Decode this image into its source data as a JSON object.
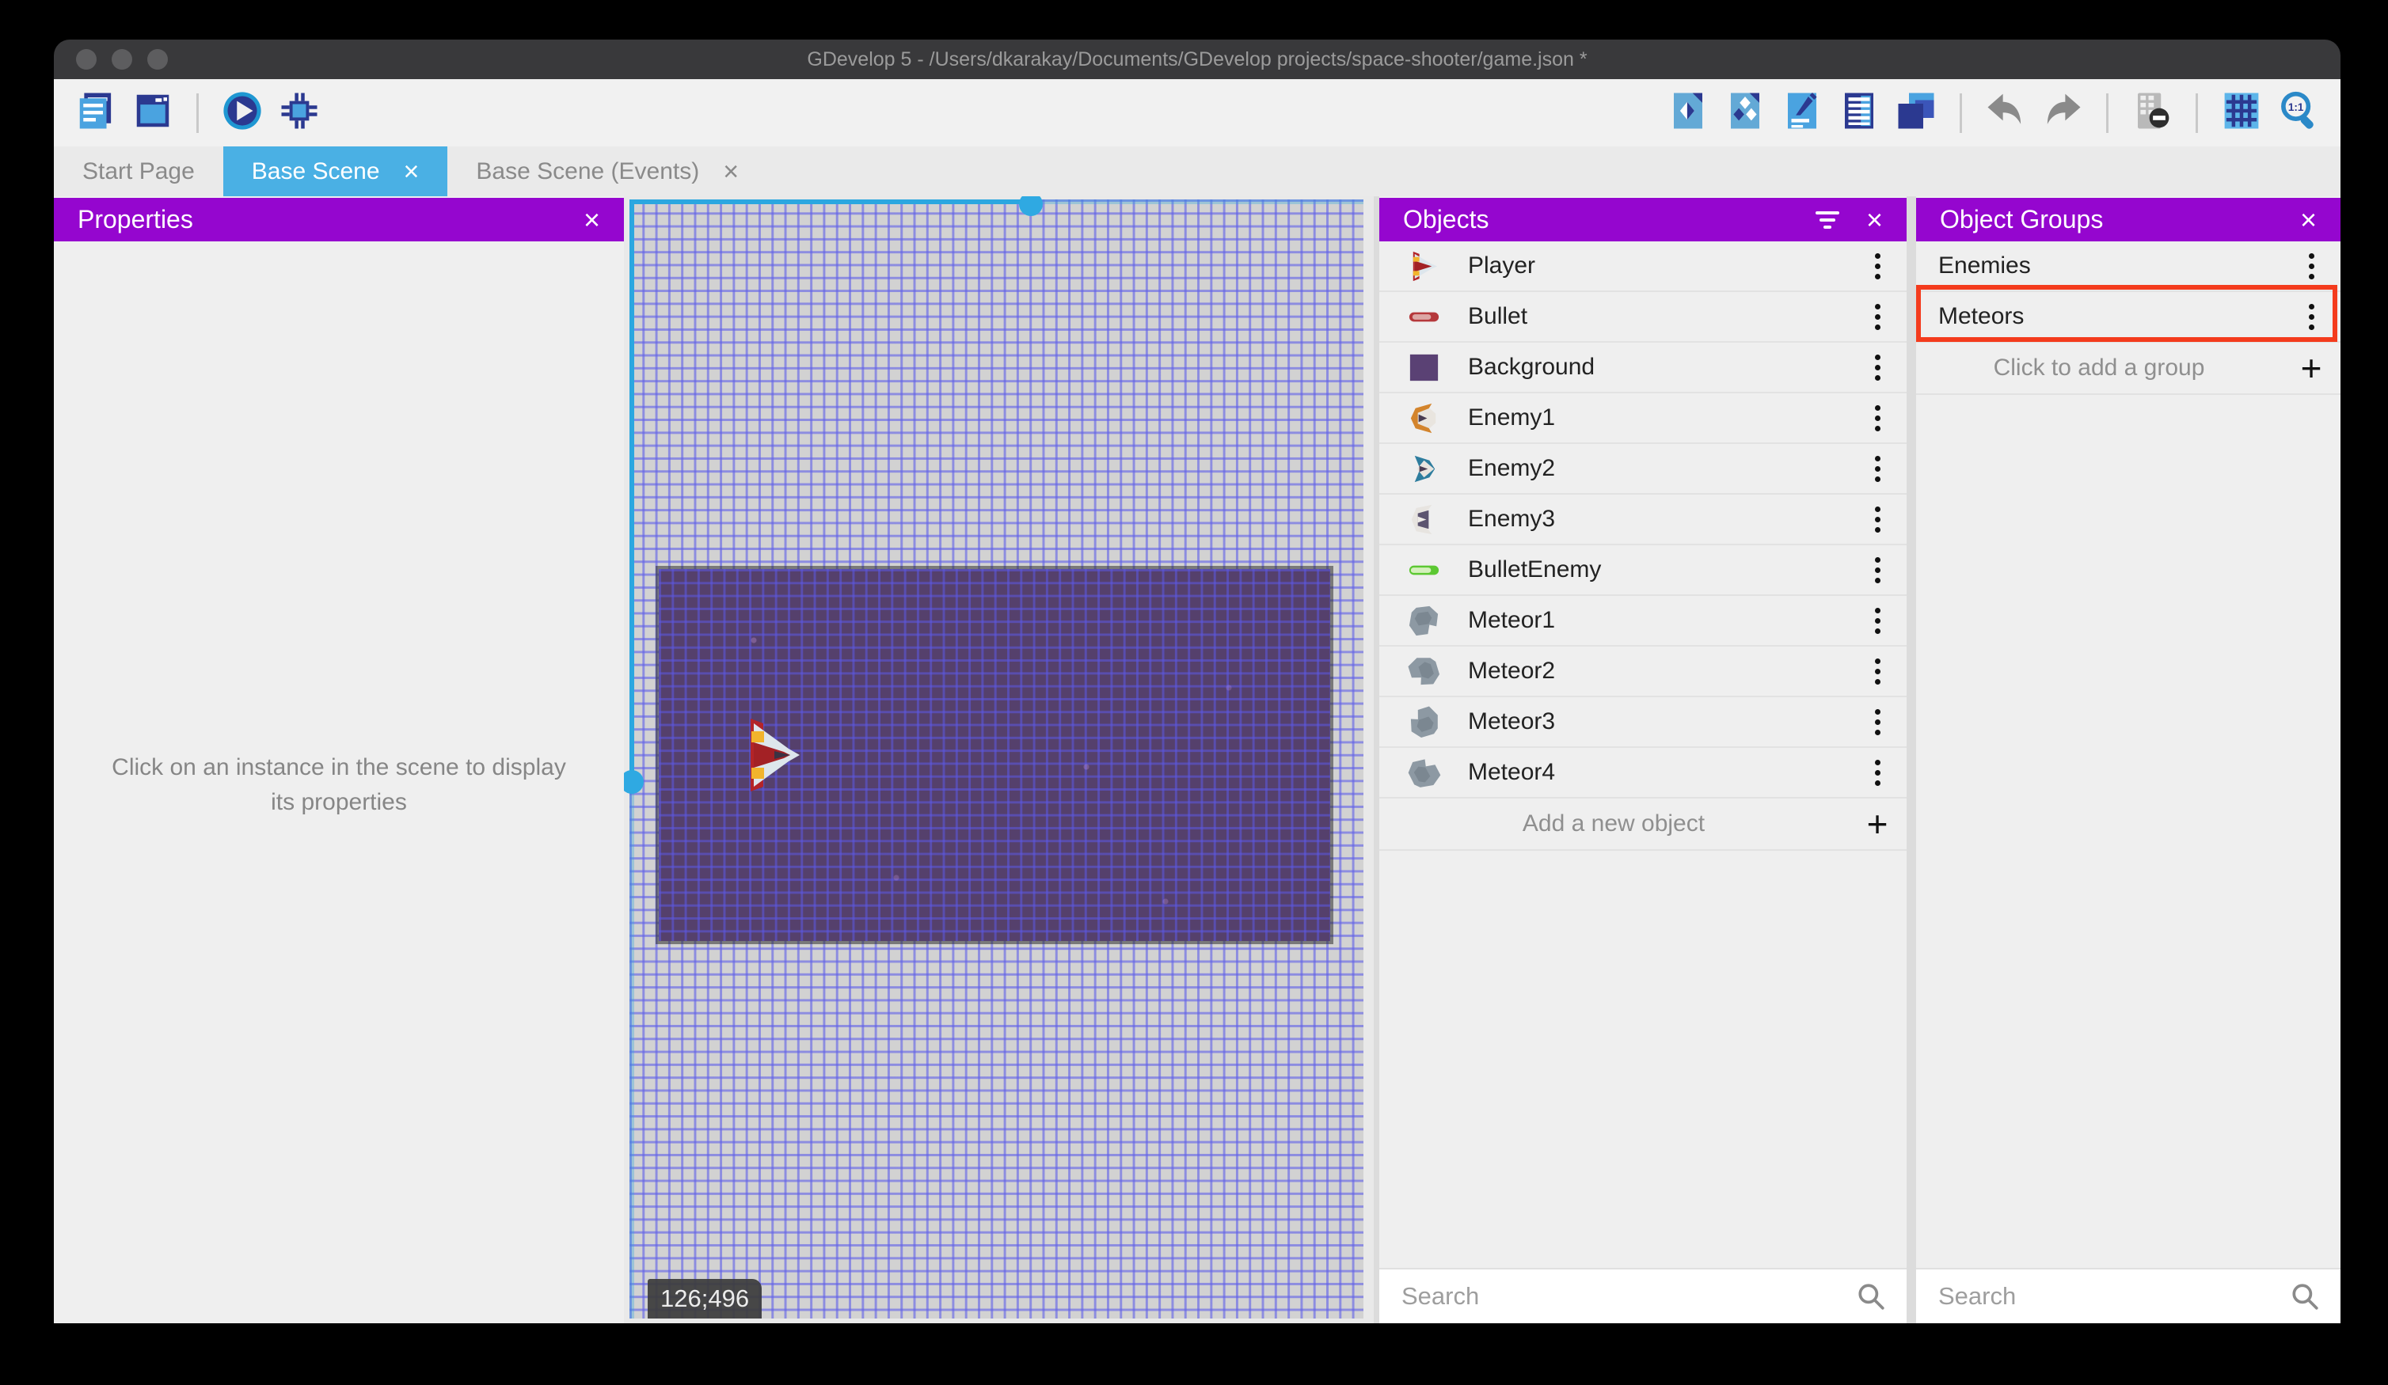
{
  "window": {
    "title": "GDevelop 5 - /Users/dkarakay/Documents/GDevelop projects/space-shooter/game.json *"
  },
  "toolbar": {
    "left": [
      {
        "name": "project-manager",
        "icon": "project-manager"
      },
      {
        "name": "start-page",
        "icon": "scene-window"
      },
      {
        "separator": true
      },
      {
        "name": "play",
        "icon": "play"
      },
      {
        "name": "debug",
        "icon": "debug"
      }
    ],
    "right": [
      {
        "name": "open-objects-panel",
        "icon": "objects-page"
      },
      {
        "name": "open-object-groups-panel",
        "icon": "object-groups-page"
      },
      {
        "name": "open-properties-panel",
        "icon": "properties-page"
      },
      {
        "name": "open-instances-list-panel",
        "icon": "instances-page"
      },
      {
        "name": "open-layers-panel",
        "icon": "layers"
      },
      {
        "separator": true
      },
      {
        "name": "undo",
        "icon": "undo"
      },
      {
        "name": "redo",
        "icon": "redo"
      },
      {
        "separator": true
      },
      {
        "name": "toggle-instances-mask",
        "icon": "mask"
      },
      {
        "separator": true
      },
      {
        "name": "toggle-grid",
        "icon": "grid"
      },
      {
        "name": "zoom-original",
        "icon": "zoom-1-1"
      }
    ]
  },
  "tabs": [
    {
      "label": "Start Page",
      "active": false,
      "closable": false
    },
    {
      "label": "Base Scene",
      "active": true,
      "closable": true
    },
    {
      "label": "Base Scene (Events)",
      "active": false,
      "closable": true
    }
  ],
  "properties_panel": {
    "title": "Properties",
    "empty_text": "Click on an instance in the scene to display its properties"
  },
  "scene_canvas": {
    "cursor_coordinates": "126;496"
  },
  "objects_panel": {
    "title": "Objects",
    "items": [
      {
        "name": "Player",
        "icon": "player"
      },
      {
        "name": "Bullet",
        "icon": "bullet"
      },
      {
        "name": "Background",
        "icon": "background"
      },
      {
        "name": "Enemy1",
        "icon": "enemy1"
      },
      {
        "name": "Enemy2",
        "icon": "enemy2"
      },
      {
        "name": "Enemy3",
        "icon": "enemy3"
      },
      {
        "name": "BulletEnemy",
        "icon": "bullet-enemy"
      },
      {
        "name": "Meteor1",
        "icon": "meteor1"
      },
      {
        "name": "Meteor2",
        "icon": "meteor2"
      },
      {
        "name": "Meteor3",
        "icon": "meteor3"
      },
      {
        "name": "Meteor4",
        "icon": "meteor4"
      }
    ],
    "add_label": "Add a new object",
    "search_placeholder": "Search"
  },
  "object_groups_panel": {
    "title": "Object Groups",
    "groups": [
      {
        "name": "Enemies",
        "highlighted": false
      },
      {
        "name": "Meteors",
        "highlighted": true
      }
    ],
    "add_label": "Click to add a group",
    "search_placeholder": "Search"
  },
  "colors": {
    "header_purple": "#9506cf",
    "active_tab_blue": "#4ab0e4",
    "selection_blue": "#2ba7e0",
    "annotation_red": "#f43b1d",
    "scene_background_purple": "#55406c"
  }
}
